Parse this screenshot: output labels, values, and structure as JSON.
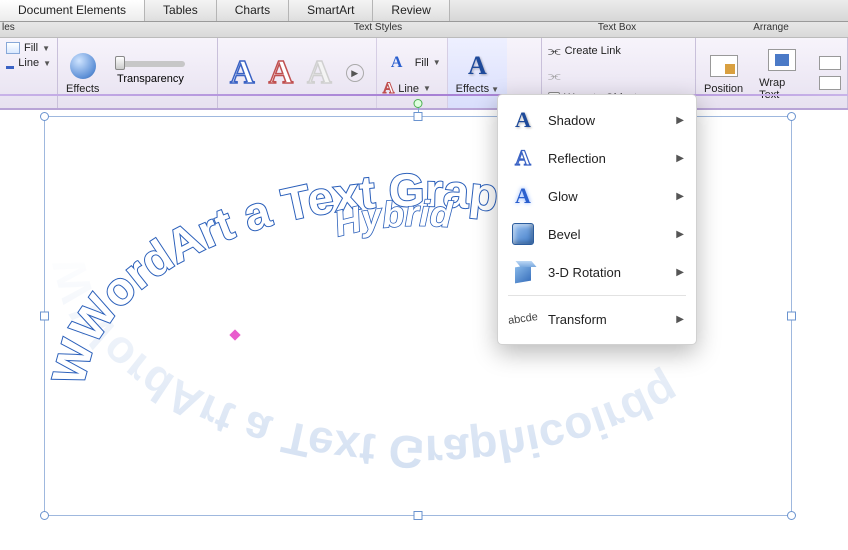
{
  "tabs": [
    "Document Elements",
    "Tables",
    "Charts",
    "SmartArt",
    "Review"
  ],
  "activeTab": 0,
  "groupLabels": {
    "styles": "les",
    "textStyles": "Text Styles",
    "textBox": "Text Box",
    "arrange": "Arrange"
  },
  "quick": {
    "fill": "Fill",
    "line": "Line"
  },
  "effectsBtn": "Effects",
  "transparency": "Transparency",
  "galLetter": "A",
  "fillLabel": "Fill",
  "lineLabel": "Line",
  "effects2": "Effects",
  "textBox": {
    "createLink": "Create Link",
    "wrapToObject": "Wrap to Object"
  },
  "arrange": {
    "position": "Position",
    "wrapText": "Wrap Text"
  },
  "menu": {
    "shadow": "Shadow",
    "reflection": "Reflection",
    "glow": "Glow",
    "bevel": "Bevel",
    "rotation": "3-D Rotation",
    "transform": "Transform",
    "abcde": "abcde"
  },
  "wordart": {
    "outer": "WWordArt a Text Graphicoirdq",
    "inner": "Hybrid"
  }
}
